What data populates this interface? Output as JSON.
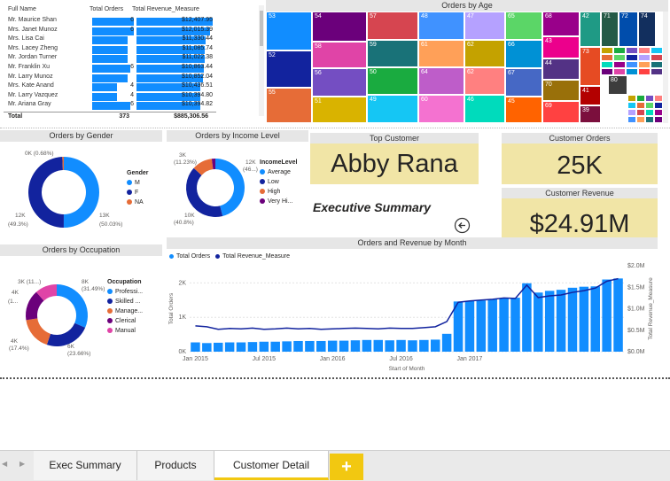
{
  "table": {
    "headers": [
      "Full Name",
      "Total Orders",
      "Total Revenue_Measure"
    ],
    "rows": [
      {
        "name": "Mr. Maurice Shan",
        "orders": "6",
        "revenue": "$12,407.95"
      },
      {
        "name": "Mrs. Janet Munoz",
        "orders": "6",
        "revenue": "$12,015.39"
      },
      {
        "name": "Mrs. Lisa Cai",
        "orders": "",
        "revenue": "$11,330.44"
      },
      {
        "name": "Mrs. Lacey Zheng",
        "orders": "",
        "revenue": "$11,085.74"
      },
      {
        "name": "Mr. Jordan Turner",
        "orders": "",
        "revenue": "$11,022.38"
      },
      {
        "name": "Mr. Franklin Xu",
        "orders": "6",
        "revenue": "$10,863.44"
      },
      {
        "name": "Mr. Larry Munoz",
        "orders": "",
        "revenue": "$10,852.04"
      },
      {
        "name": "Mrs. Kate Anand",
        "orders": "4",
        "revenue": "$10,436.51"
      },
      {
        "name": "Mr. Larry Vazquez",
        "orders": "4",
        "revenue": "$10,394.80"
      },
      {
        "name": "Mr. Ariana Gray",
        "orders": "6",
        "revenue": "$10,394.82"
      }
    ],
    "bar_fill": [
      1.0,
      1.0,
      0.85,
      0.85,
      0.85,
      0.92,
      0.85,
      0.6,
      0.6,
      0.92
    ],
    "rev_fill": [
      1.0,
      0.97,
      0.91,
      0.89,
      0.89,
      0.88,
      0.87,
      0.84,
      0.84,
      0.84
    ],
    "total_label": "Total",
    "total_orders": "373",
    "total_revenue": "$885,306.56"
  },
  "treemap": {
    "title": "Orders by Age",
    "cells": [
      {
        "label": "53",
        "color": "#118dff"
      },
      {
        "label": "52",
        "color": "#12239e"
      },
      {
        "label": "55",
        "color": "#e66c37"
      },
      {
        "label": "54",
        "color": "#6b007b"
      },
      {
        "label": "58",
        "color": "#e044a7"
      },
      {
        "label": "56",
        "color": "#744ec2"
      },
      {
        "label": "51",
        "color": "#d9b300"
      },
      {
        "label": "57",
        "color": "#d64550"
      },
      {
        "label": "59",
        "color": "#197278"
      },
      {
        "label": "50",
        "color": "#1aab40"
      },
      {
        "label": "49",
        "color": "#15c6f4"
      },
      {
        "label": "48",
        "color": "#4092ff"
      },
      {
        "label": "61",
        "color": "#ffa058"
      },
      {
        "label": "64",
        "color": "#be5dc9"
      },
      {
        "label": "60",
        "color": "#f472d0"
      },
      {
        "label": "47",
        "color": "#b5a1ff"
      },
      {
        "label": "62",
        "color": "#c4a200"
      },
      {
        "label": "62",
        "color": "#ff8080"
      },
      {
        "label": "46",
        "color": "#00dbbc"
      },
      {
        "label": "65",
        "color": "#5bd667"
      },
      {
        "label": "66",
        "color": "#0091d5"
      },
      {
        "label": "67",
        "color": "#4668c5"
      },
      {
        "label": "45",
        "color": "#ff6300"
      },
      {
        "label": "68",
        "color": "#99008a"
      },
      {
        "label": "43",
        "color": "#ec008c"
      },
      {
        "label": "44",
        "color": "#533285"
      },
      {
        "label": "70",
        "color": "#99700a"
      },
      {
        "label": "69",
        "color": "#ff4141"
      },
      {
        "label": "42",
        "color": "#1f9a85"
      },
      {
        "label": "73",
        "color": "#e64b23"
      },
      {
        "label": "41",
        "color": "#b30000"
      },
      {
        "label": "39",
        "color": "#7b0f3d"
      },
      {
        "label": "71",
        "color": "#255a46"
      },
      {
        "label": "72",
        "color": "#004dac"
      },
      {
        "label": "74",
        "color": "#122f5e"
      },
      {
        "label": "80",
        "color": "#3d3d3d"
      }
    ]
  },
  "gender": {
    "title": "Orders by Gender",
    "legend_title": "Gender",
    "legend": [
      {
        "label": "M",
        "color": "#118dff"
      },
      {
        "label": "F",
        "color": "#12239e"
      },
      {
        "label": "NA",
        "color": "#e66c37"
      }
    ],
    "values": [
      50.03,
      49.3,
      0.68
    ],
    "labels": {
      "top": "0K (0.68%)",
      "left": "12K",
      "left2": "(49.3%)",
      "right": "13K",
      "right2": "(50.03%)"
    }
  },
  "income": {
    "title": "Orders by Income Level",
    "legend_title": "IncomeLevel",
    "legend": [
      {
        "label": "Average",
        "color": "#118dff"
      },
      {
        "label": "Low",
        "color": "#12239e"
      },
      {
        "label": "High",
        "color": "#e66c37"
      },
      {
        "label": "Very Hi...",
        "color": "#6b007b"
      }
    ],
    "values": [
      46,
      40.8,
      11.23,
      1.97
    ],
    "labels": {
      "tl": "3K",
      "tl2": "(11.23%)",
      "tr": "12K",
      "tr2": "(46...)",
      "bl": "10K",
      "bl2": "(40.8%)"
    }
  },
  "occupation": {
    "title": "Orders by Occupation",
    "legend_title": "Occupation",
    "legend": [
      {
        "label": "Professi...",
        "color": "#118dff"
      },
      {
        "label": "Skilled ...",
        "color": "#12239e"
      },
      {
        "label": "Manage...",
        "color": "#e66c37"
      },
      {
        "label": "Clerical",
        "color": "#6b007b"
      },
      {
        "label": "Manual",
        "color": "#e044a7"
      }
    ],
    "values": [
      31.49,
      23.66,
      17.4,
      16,
      11.45
    ],
    "labels": {
      "tr": "8K",
      "tr2": "(31.49%)",
      "br": "6K",
      "br2": "(23.66%)",
      "l": "4K",
      "l2": "(17.4%)",
      "tl": "3K (11...)",
      "ml": "4K",
      "ml2": "(1..."
    }
  },
  "top_customer": {
    "head": "Top Customer",
    "value": "Abby Rana"
  },
  "customer_orders": {
    "head": "Customer Orders",
    "value": "25K"
  },
  "customer_revenue": {
    "head": "Customer Revenue",
    "value": "$24.91M"
  },
  "exec_summary": "Executive Summary",
  "back_icon": "back-arrow-icon",
  "month_chart_title": "Orders and Revenue by Month",
  "chart_data": {
    "type": "bar",
    "title": "Orders and Revenue by Month",
    "legend": [
      "Total Orders",
      "Total Revenue_Measure"
    ],
    "xlabel": "Start of Month",
    "ylabel": "Total Orders",
    "y2label": "Total Revenue_Measure",
    "x_ticks": [
      "Jan 2015",
      "Jul 2015",
      "Jan 2016",
      "Jul 2016",
      "Jan 2017"
    ],
    "y_ticks": [
      "0K",
      "1K",
      "2K"
    ],
    "y2_ticks": [
      "$0.0M",
      "$0.5M",
      "$1.0M",
      "$1.5M",
      "$2.0M"
    ],
    "ylim": [
      0,
      2500
    ],
    "y2lim": [
      0,
      2.0
    ],
    "series": [
      {
        "name": "Total Orders",
        "values": [
          270,
          250,
          260,
          270,
          270,
          280,
          290,
          290,
          300,
          310,
          310,
          310,
          320,
          320,
          330,
          340,
          340,
          330,
          340,
          330,
          340,
          350,
          520,
          1460,
          1480,
          1490,
          1520,
          1560,
          1570,
          1990,
          1720,
          1770,
          1800,
          1860,
          1890,
          1900,
          2100,
          2130
        ]
      },
      {
        "name": "Total Revenue_Measure",
        "values": [
          0.6,
          0.58,
          0.52,
          0.54,
          0.53,
          0.55,
          0.52,
          0.53,
          0.55,
          0.53,
          0.54,
          0.52,
          0.53,
          0.54,
          0.55,
          0.54,
          0.53,
          0.55,
          0.54,
          0.54,
          0.56,
          0.58,
          0.7,
          1.15,
          1.18,
          1.2,
          1.22,
          1.25,
          1.24,
          1.55,
          1.26,
          1.3,
          1.32,
          1.38,
          1.42,
          1.48,
          1.64,
          1.7
        ]
      }
    ],
    "colors": [
      "#118dff",
      "#12239e"
    ]
  },
  "tabs": [
    {
      "label": "Exec Summary"
    },
    {
      "label": "Products"
    },
    {
      "label": "Customer Detail"
    }
  ],
  "add_tab": "+",
  "nav_prev": "◀",
  "nav_next": "▶"
}
